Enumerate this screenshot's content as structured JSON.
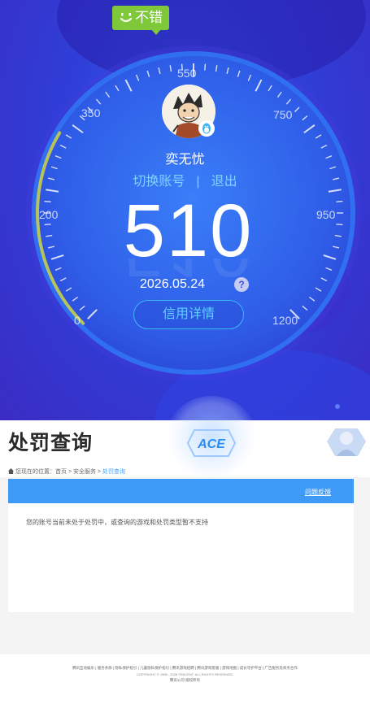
{
  "credit": {
    "badge_label": "不错",
    "nickname": "奕无忧",
    "switch_account": "切换账号",
    "separator": "|",
    "logout": "退出",
    "score": "510",
    "score_level_fraction": 0.281,
    "date": "2026.05.24",
    "help_symbol": "?",
    "detail_button": "信用详情",
    "gauge_labels": [
      "0",
      "200",
      "350",
      "550",
      "750",
      "950",
      "1200"
    ],
    "colors": {
      "badge": "#7ec83a",
      "progress_arc": "#b8c35a",
      "link": "#7fd3ff",
      "button_border": "#39b8ff"
    },
    "icons": {
      "badge": "smile-icon",
      "avatar": "user-avatar",
      "qq": "qq-penguin-icon",
      "help": "question-icon"
    }
  },
  "penalty": {
    "title": "处罚查询",
    "logo_text": "ACE",
    "breadcrumb": {
      "prefix": "您现在的位置：",
      "home": "首页",
      "sep": " > ",
      "service": "安全服务",
      "current": "处罚查询"
    },
    "appeal_link": "问题反馈",
    "result_message": "您的账号当前未处于处罚中，或查询的游戏和处罚类型暂不支持",
    "colors": {
      "bar": "#3d9bf7",
      "current_crumb": "#3da0ff"
    }
  },
  "footer": {
    "links": "腾讯互动娱乐 | 服务条款 | 隐私保护指引 | 儿童隐私保护指引 | 腾讯游戏招聘 | 腾讯游戏客服 | 游戏地图 | 成长守护平台 | 广告服务及商务合作",
    "copyright": "COPYRIGHT © 1998 - 2026 TENCENT. ALL RIGHTS RESERVED.",
    "company": "腾讯公司 版权所有"
  }
}
